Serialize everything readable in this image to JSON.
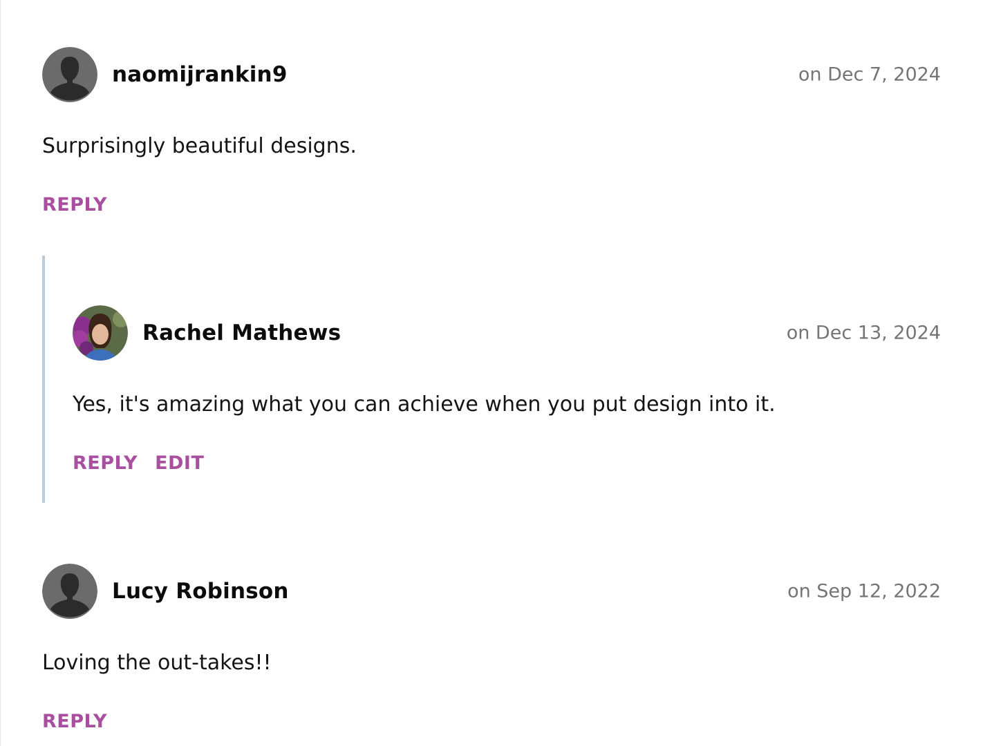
{
  "comments": [
    {
      "author": "naomijrankin9",
      "date": "on Dec 7, 2024",
      "text": "Surprisingly beautiful designs.",
      "avatar": "default-avatar-icon",
      "actions": [
        "REPLY"
      ]
    },
    {
      "author": "Rachel Mathews",
      "date": "on Dec 13, 2024",
      "text": "Yes, it's amazing what you can achieve when you put design into it.",
      "avatar": "user-photo",
      "actions": [
        "REPLY",
        "EDIT"
      ],
      "is_reply": true
    },
    {
      "author": "Lucy Robinson",
      "date": "on Sep 12, 2022",
      "text": "Loving the out-takes!!",
      "avatar": "default-avatar-icon",
      "actions": [
        "REPLY"
      ]
    }
  ],
  "colors": {
    "action": "#a8509f",
    "date": "#757575",
    "thread_line": "#bccbd8",
    "avatar_bg": "#6b6b6b",
    "avatar_silhouette": "#2b2b2b"
  }
}
